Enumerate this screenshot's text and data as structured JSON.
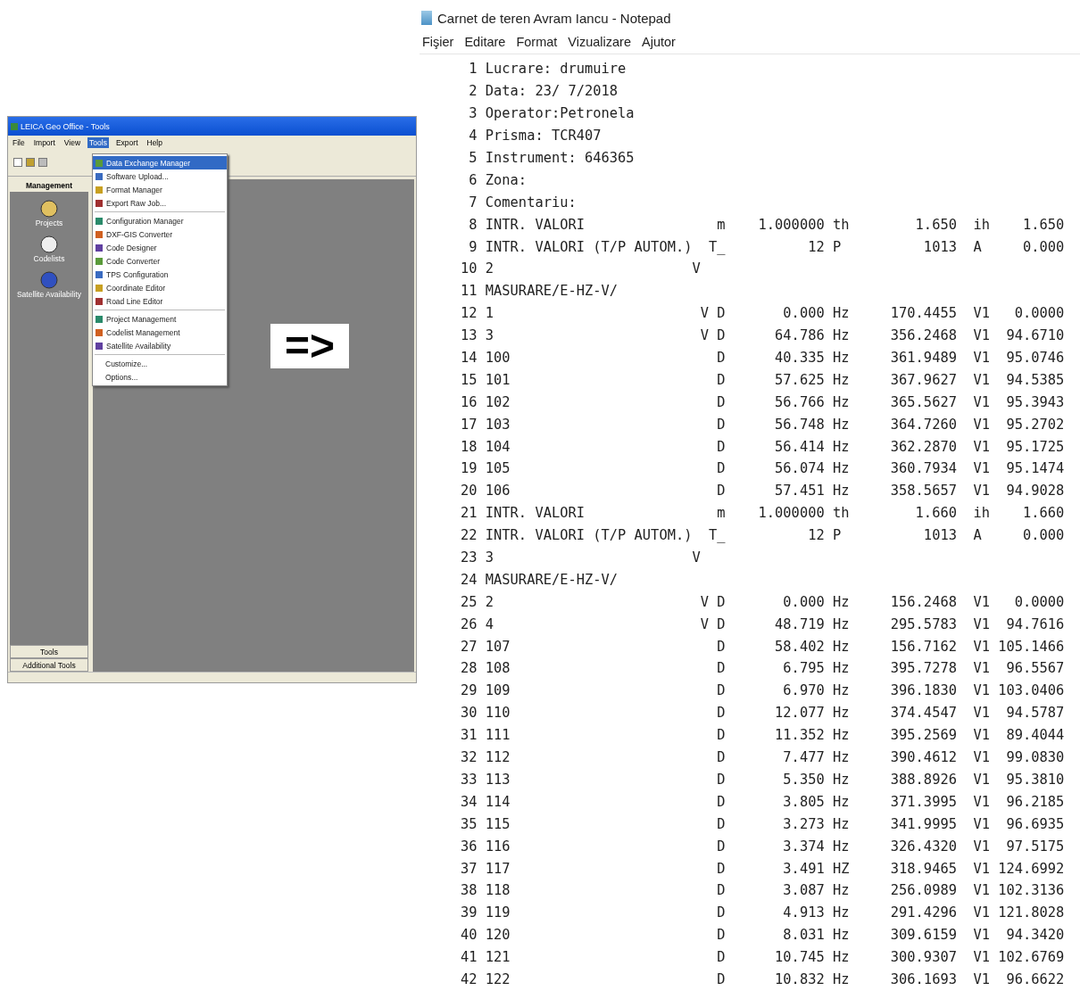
{
  "left_screenshot": {
    "title": "LEICA Geo Office - Tools",
    "menu": [
      {
        "label": "File",
        "selected": false
      },
      {
        "label": "Import",
        "selected": false
      },
      {
        "label": "View",
        "selected": false
      },
      {
        "label": "Tools",
        "selected": true
      },
      {
        "label": "Export",
        "selected": false
      },
      {
        "label": "Help",
        "selected": false
      }
    ],
    "sidebar": {
      "header": "Management",
      "items": [
        "Projects",
        "Codelists",
        "Satellite Availability"
      ],
      "buttons": [
        "Tools",
        "Additional Tools"
      ]
    },
    "dropdown": [
      {
        "kind": "item",
        "label": "Data Exchange Manager",
        "selected": true
      },
      {
        "kind": "item",
        "label": "Software Upload...",
        "selected": false
      },
      {
        "kind": "item",
        "label": "Format Manager",
        "selected": false
      },
      {
        "kind": "item",
        "label": "Export Raw Job...",
        "selected": false
      },
      {
        "kind": "separator"
      },
      {
        "kind": "item",
        "label": "Configuration Manager",
        "selected": false
      },
      {
        "kind": "item",
        "label": "DXF-GIS Converter",
        "selected": false
      },
      {
        "kind": "item",
        "label": "Code Designer",
        "selected": false
      },
      {
        "kind": "item",
        "label": "Code Converter",
        "selected": false
      },
      {
        "kind": "item",
        "label": "TPS Configuration",
        "selected": false
      },
      {
        "kind": "item",
        "label": "Coordinate Editor",
        "selected": false
      },
      {
        "kind": "item",
        "label": "Road Line Editor",
        "selected": false
      },
      {
        "kind": "separator"
      },
      {
        "kind": "item",
        "label": "Project Management",
        "selected": false
      },
      {
        "kind": "item",
        "label": "Codelist Management",
        "selected": false
      },
      {
        "kind": "item",
        "label": "Satellite Availability",
        "selected": false
      },
      {
        "kind": "separator"
      },
      {
        "kind": "plain",
        "label": "Customize...",
        "selected": false
      },
      {
        "kind": "plain",
        "label": "Options...",
        "selected": false
      }
    ]
  },
  "arrow": "=>",
  "notepad": {
    "title": "Carnet de teren Avram Iancu - Notepad",
    "menu": [
      "Fişier",
      "Editare",
      "Format",
      "Vizualizare",
      "Ajutor"
    ],
    "lines": [
      {
        "kind": "text",
        "n": "1",
        "text": "Lucrare: drumuire"
      },
      {
        "kind": "text",
        "n": "2",
        "text": "Data: 23/ 7/2018"
      },
      {
        "kind": "text",
        "n": "3",
        "text": "Operator:Petronela"
      },
      {
        "kind": "text",
        "n": "4",
        "text": "Prisma: TCR407"
      },
      {
        "kind": "text",
        "n": "5",
        "text": "Instrument: 646365"
      },
      {
        "kind": "text",
        "n": "6",
        "text": "Zona:"
      },
      {
        "kind": "text",
        "n": "7",
        "text": "Comentariu:"
      },
      {
        "kind": "data",
        "n": "8",
        "name": "INTR. VALORI",
        "flag": "m",
        "value": "1.000000",
        "unit": "th",
        "value2": "1.650",
        "unit2": "ih",
        "value3": "1.650"
      },
      {
        "kind": "data",
        "n": "9",
        "name": "INTR. VALORI (T/P AUTOM.)",
        "flag": "T_",
        "value": "12",
        "unit": "P",
        "value2": "1013",
        "unit2": "A",
        "value3": "0.000"
      },
      {
        "kind": "station",
        "n": "10",
        "name": "2",
        "flag": "V"
      },
      {
        "kind": "text",
        "n": "11",
        "text": "MASURARE/E-HZ-V/"
      },
      {
        "kind": "data",
        "n": "12",
        "name": "1",
        "flag": "V D",
        "value": "0.000",
        "unit": "Hz",
        "value2": "170.4455",
        "unit2": "V1",
        "value3": "0.0000"
      },
      {
        "kind": "data",
        "n": "13",
        "name": "3",
        "flag": "V D",
        "value": "64.786",
        "unit": "Hz",
        "value2": "356.2468",
        "unit2": "V1",
        "value3": "94.6710"
      },
      {
        "kind": "data",
        "n": "14",
        "name": "100",
        "flag": "D",
        "value": "40.335",
        "unit": "Hz",
        "value2": "361.9489",
        "unit2": "V1",
        "value3": "95.0746"
      },
      {
        "kind": "data",
        "n": "15",
        "name": "101",
        "flag": "D",
        "value": "57.625",
        "unit": "Hz",
        "value2": "367.9627",
        "unit2": "V1",
        "value3": "94.5385"
      },
      {
        "kind": "data",
        "n": "16",
        "name": "102",
        "flag": "D",
        "value": "56.766",
        "unit": "Hz",
        "value2": "365.5627",
        "unit2": "V1",
        "value3": "95.3943"
      },
      {
        "kind": "data",
        "n": "17",
        "name": "103",
        "flag": "D",
        "value": "56.748",
        "unit": "Hz",
        "value2": "364.7260",
        "unit2": "V1",
        "value3": "95.2702"
      },
      {
        "kind": "data",
        "n": "18",
        "name": "104",
        "flag": "D",
        "value": "56.414",
        "unit": "Hz",
        "value2": "362.2870",
        "unit2": "V1",
        "value3": "95.1725"
      },
      {
        "kind": "data",
        "n": "19",
        "name": "105",
        "flag": "D",
        "value": "56.074",
        "unit": "Hz",
        "value2": "360.7934",
        "unit2": "V1",
        "value3": "95.1474"
      },
      {
        "kind": "data",
        "n": "20",
        "name": "106",
        "flag": "D",
        "value": "57.451",
        "unit": "Hz",
        "value2": "358.5657",
        "unit2": "V1",
        "value3": "94.9028"
      },
      {
        "kind": "data",
        "n": "21",
        "name": "INTR. VALORI",
        "flag": "m",
        "value": "1.000000",
        "unit": "th",
        "value2": "1.660",
        "unit2": "ih",
        "value3": "1.660"
      },
      {
        "kind": "data",
        "n": "22",
        "name": "INTR. VALORI (T/P AUTOM.)",
        "flag": "T_",
        "value": "12",
        "unit": "P",
        "value2": "1013",
        "unit2": "A",
        "value3": "0.000"
      },
      {
        "kind": "station",
        "n": "23",
        "name": "3",
        "flag": "V"
      },
      {
        "kind": "text",
        "n": "24",
        "text": "MASURARE/E-HZ-V/"
      },
      {
        "kind": "data",
        "n": "25",
        "name": "2",
        "flag": "V D",
        "value": "0.000",
        "unit": "Hz",
        "value2": "156.2468",
        "unit2": "V1",
        "value3": "0.0000"
      },
      {
        "kind": "data",
        "n": "26",
        "name": "4",
        "flag": "V D",
        "value": "48.719",
        "unit": "Hz",
        "value2": "295.5783",
        "unit2": "V1",
        "value3": "94.7616"
      },
      {
        "kind": "data",
        "n": "27",
        "name": "107",
        "flag": "D",
        "value": "58.402",
        "unit": "Hz",
        "value2": "156.7162",
        "unit2": "V1",
        "value3": "105.1466"
      },
      {
        "kind": "data",
        "n": "28",
        "name": "108",
        "flag": "D",
        "value": "6.795",
        "unit": "Hz",
        "value2": "395.7278",
        "unit2": "V1",
        "value3": "96.5567"
      },
      {
        "kind": "data",
        "n": "29",
        "name": "109",
        "flag": "D",
        "value": "6.970",
        "unit": "Hz",
        "value2": "396.1830",
        "unit2": "V1",
        "value3": "103.0406"
      },
      {
        "kind": "data",
        "n": "30",
        "name": "110",
        "flag": "D",
        "value": "12.077",
        "unit": "Hz",
        "value2": "374.4547",
        "unit2": "V1",
        "value3": "94.5787"
      },
      {
        "kind": "data",
        "n": "31",
        "name": "111",
        "flag": "D",
        "value": "11.352",
        "unit": "Hz",
        "value2": "395.2569",
        "unit2": "V1",
        "value3": "89.4044"
      },
      {
        "kind": "data",
        "n": "32",
        "name": "112",
        "flag": "D",
        "value": "7.477",
        "unit": "Hz",
        "value2": "390.4612",
        "unit2": "V1",
        "value3": "99.0830"
      },
      {
        "kind": "data",
        "n": "33",
        "name": "113",
        "flag": "D",
        "value": "5.350",
        "unit": "Hz",
        "value2": "388.8926",
        "unit2": "V1",
        "value3": "95.3810"
      },
      {
        "kind": "data",
        "n": "34",
        "name": "114",
        "flag": "D",
        "value": "3.805",
        "unit": "Hz",
        "value2": "371.3995",
        "unit2": "V1",
        "value3": "96.2185"
      },
      {
        "kind": "data",
        "n": "35",
        "name": "115",
        "flag": "D",
        "value": "3.273",
        "unit": "Hz",
        "value2": "341.9995",
        "unit2": "V1",
        "value3": "96.6935"
      },
      {
        "kind": "data",
        "n": "36",
        "name": "116",
        "flag": "D",
        "value": "3.374",
        "unit": "Hz",
        "value2": "326.4320",
        "unit2": "V1",
        "value3": "97.5175"
      },
      {
        "kind": "data",
        "n": "37",
        "name": "117",
        "flag": "D",
        "value": "3.491",
        "unit": "HZ",
        "value2": "318.9465",
        "unit2": "V1",
        "value3": "124.6992"
      },
      {
        "kind": "data",
        "n": "38",
        "name": "118",
        "flag": "D",
        "value": "3.087",
        "unit": "Hz",
        "value2": "256.0989",
        "unit2": "V1",
        "value3": "102.3136"
      },
      {
        "kind": "data",
        "n": "39",
        "name": "119",
        "flag": "D",
        "value": "4.913",
        "unit": "Hz",
        "value2": "291.4296",
        "unit2": "V1",
        "value3": "121.8028"
      },
      {
        "kind": "data",
        "n": "40",
        "name": "120",
        "flag": "D",
        "value": "8.031",
        "unit": "Hz",
        "value2": "309.6159",
        "unit2": "V1",
        "value3": "94.3420"
      },
      {
        "kind": "data",
        "n": "41",
        "name": "121",
        "flag": "D",
        "value": "10.745",
        "unit": "Hz",
        "value2": "300.9307",
        "unit2": "V1",
        "value3": "102.6769"
      },
      {
        "kind": "data",
        "n": "42",
        "name": "122",
        "flag": "D",
        "value": "10.832",
        "unit": "Hz",
        "value2": "306.1693",
        "unit2": "V1",
        "value3": "96.6622"
      }
    ]
  }
}
